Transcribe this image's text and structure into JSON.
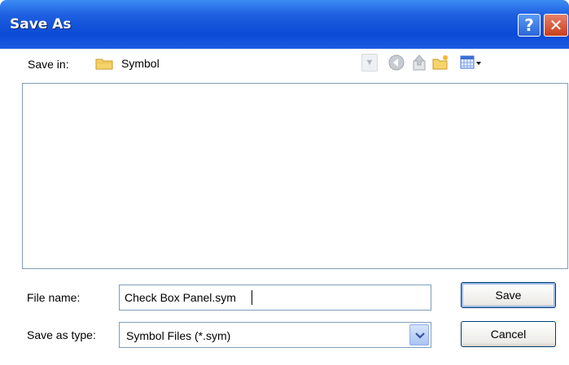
{
  "window": {
    "title": "Save As",
    "help_glyph": "?",
    "close_glyph": "✕"
  },
  "save_in": {
    "label": "Save in:",
    "value": "Symbol",
    "icons": [
      "folder-icon",
      "back-arrow-icon",
      "up-folder-icon",
      "new-folder-icon",
      "view-menu-icon"
    ]
  },
  "file_name": {
    "label": "File name:",
    "value": "Check Box Panel.sym"
  },
  "save_as_type": {
    "label": "Save as type:",
    "value": "Symbol Files (*.sym)"
  },
  "buttons": {
    "save": "Save",
    "cancel": "Cancel"
  },
  "colors": {
    "title_bar": "#0a4ad6",
    "close_button": "#c8401d",
    "field_border": "#7f9db9"
  }
}
